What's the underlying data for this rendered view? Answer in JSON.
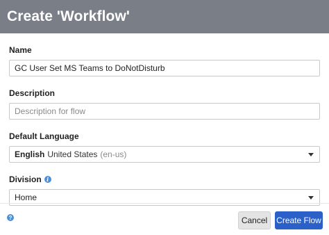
{
  "dialog": {
    "title": "Create 'Workflow'"
  },
  "form": {
    "name": {
      "label": "Name",
      "value": "GC User Set MS Teams to DoNotDisturb"
    },
    "description": {
      "label": "Description",
      "value": "",
      "placeholder": "Description for flow"
    },
    "language": {
      "label": "Default Language",
      "selected_bold": "English",
      "selected_rest": "United States",
      "selected_code": "(en-us)"
    },
    "division": {
      "label": "Division",
      "selected": "Home"
    }
  },
  "footer": {
    "help_symbol": "?",
    "cancel_label": "Cancel",
    "create_label": "Create Flow"
  },
  "icons": {
    "info": "info-icon",
    "help": "help-icon",
    "dropdown": "caret-down-icon"
  },
  "colors": {
    "header_bg": "#7a7f87",
    "primary_button": "#2a60c8",
    "info_blue": "#4a90d9"
  }
}
